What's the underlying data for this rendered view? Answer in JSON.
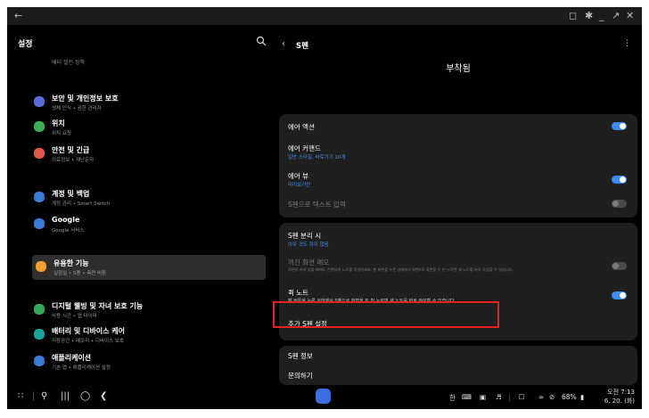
{
  "window": {
    "back_icon": "arrow-left-icon"
  },
  "left": {
    "header": "설정",
    "clipped_subtitle": "배터 절전 정책",
    "items": [
      {
        "title": "보안 및 개인정보 보호",
        "subtitle": "생체 인식 • 권한 관리자",
        "icon": "shield-icon",
        "color": "#5b6bd6"
      },
      {
        "title": "위치",
        "subtitle": "위치 요청",
        "icon": "location-pin-icon",
        "color": "#3dae56"
      },
      {
        "title": "안전 및 긴급",
        "subtitle": "의료정보 • 재난문자",
        "icon": "emergency-icon",
        "color": "#e1594a"
      },
      {
        "title": "계정 및 백업",
        "subtitle": "계정 관리 • Smart Switch",
        "icon": "sync-icon",
        "color": "#3a7bd5"
      },
      {
        "title": "Google",
        "subtitle": "Google 서비스",
        "icon": "google-icon",
        "color": "#3a7bd5"
      },
      {
        "title": "유용한 기능",
        "subtitle": "실험실 • S펜 • 측면 버튼",
        "icon": "star-icon",
        "color": "#f0a030"
      },
      {
        "title": "디지털 웰빙 및 자녀 보호 기능",
        "subtitle": "사용 시간 • 앱 타이머",
        "icon": "wellbeing-icon",
        "color": "#36a85a"
      },
      {
        "title": "배터리 및 디바이스 케어",
        "subtitle": "저장공간 • 메모리 • 디바이스 보호",
        "icon": "battery-care-icon",
        "color": "#17a59a"
      },
      {
        "title": "애플리케이션",
        "subtitle": "기본 앱 • 애플리케이션 설정",
        "icon": "apps-icon",
        "color": "#3a7bd5"
      }
    ]
  },
  "right": {
    "title": "S펜",
    "status": "부착됨",
    "card1": [
      {
        "title": "에어 액션",
        "subtitle": "",
        "toggle": "on"
      },
      {
        "title": "에어 커맨드",
        "subtitle": "일반 스타일, 바로가기 10개",
        "toggle": "none"
      },
      {
        "title": "에어 뷰",
        "subtitle": "미리보기만",
        "toggle": "on"
      },
      {
        "title": "S펜으로 텍스트 입력",
        "subtitle": "",
        "toggle": "off"
      }
    ],
    "card2": [
      {
        "title": "S펜 분리 시",
        "subtitle": "아무 것도 하지 않음",
        "toggle": "none"
      },
      {
        "title": "꺼진 화면 메모",
        "subtitle": "화면이 꺼져 있을 때에도 간편하게 노트를 작성하세요. 펜 버튼을 누른 상태에서 S펜으로 화면을 두 번 누르면 새 노트를 바로 작성할 수 있습니다.",
        "toggle": "off"
      },
      {
        "title": "퀵 노트",
        "subtitle": "펜 버튼을 누른 상태에서 S펜으로 화면을 두 번 누르면 새 노트를 바로 작성할 수 있습니다.",
        "toggle": "on"
      },
      {
        "title": "추가 S펜 설정",
        "subtitle": "",
        "toggle": "none"
      }
    ],
    "card3": [
      {
        "title": "S펜 정보"
      },
      {
        "title": "문의하기"
      }
    ]
  },
  "status_bar": {
    "ime": "한",
    "battery": "68%",
    "time": "오전 7:13",
    "date": "6. 20. (화)"
  }
}
